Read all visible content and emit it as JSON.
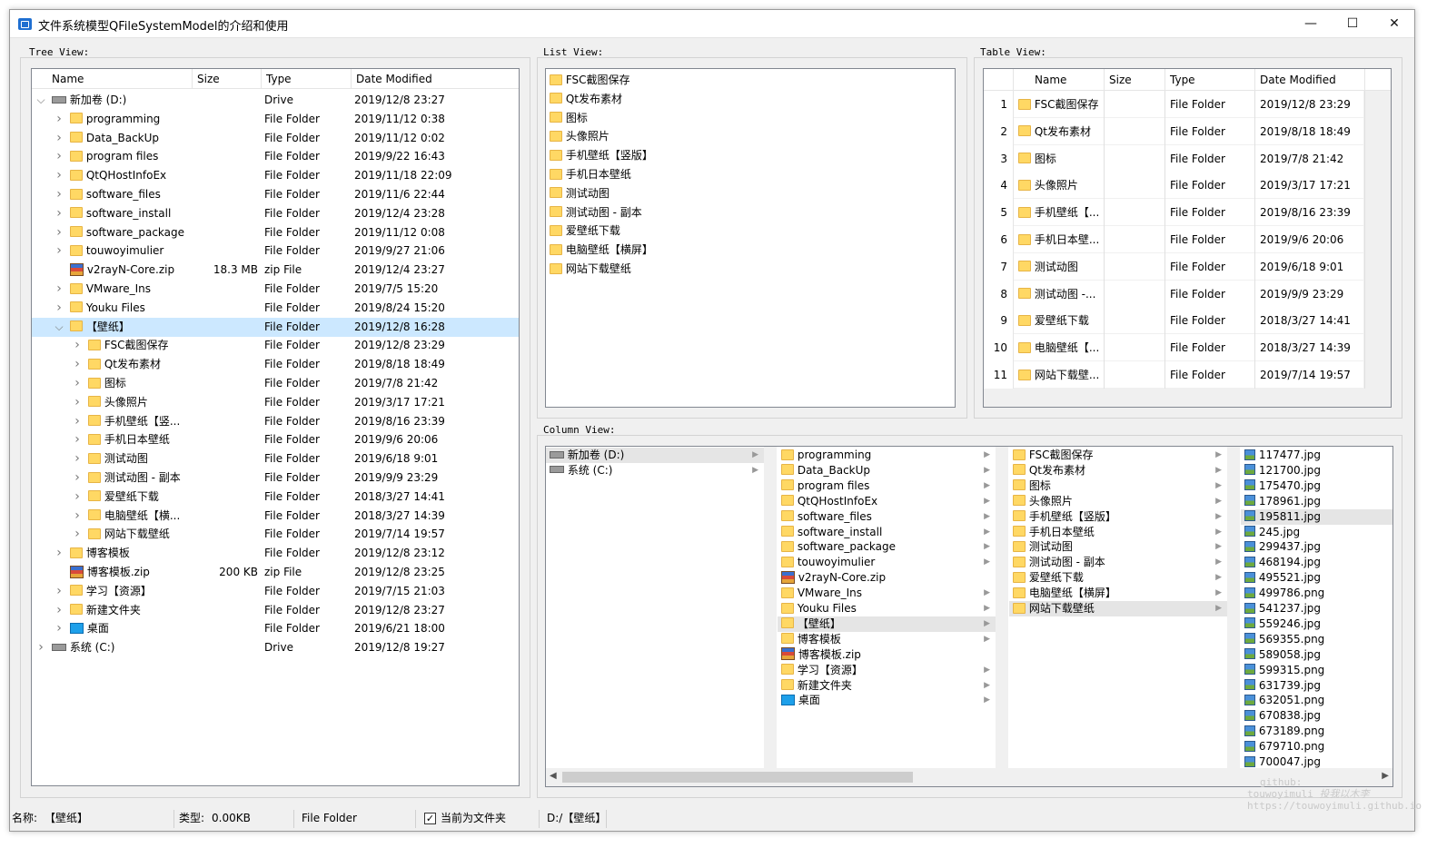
{
  "window": {
    "title": "文件系统模型QFileSystemModel的介绍和使用",
    "minimize": "—",
    "maximize": "☐",
    "close": "✕"
  },
  "groups": {
    "tree": "Tree View:",
    "list": "List View:",
    "table": "Table View:",
    "column": "Column View:"
  },
  "tree": {
    "headers": [
      "Name",
      "Size",
      "Type",
      "Date Modified"
    ],
    "rows": [
      {
        "name": "新加卷 (D:)",
        "size": "",
        "type": "Drive",
        "date": "2019/12/8 23:27",
        "icon": "drive",
        "level": 0,
        "exp": "v"
      },
      {
        "name": "programming",
        "size": "",
        "type": "File Folder",
        "date": "2019/11/12 0:38",
        "icon": "folder",
        "level": 1,
        "exp": ">"
      },
      {
        "name": "Data_BackUp",
        "size": "",
        "type": "File Folder",
        "date": "2019/11/12 0:02",
        "icon": "folder",
        "level": 1,
        "exp": ">"
      },
      {
        "name": "program files",
        "size": "",
        "type": "File Folder",
        "date": "2019/9/22 16:43",
        "icon": "folder",
        "level": 1,
        "exp": ">"
      },
      {
        "name": "QtQHostInfoEx",
        "size": "",
        "type": "File Folder",
        "date": "2019/11/18 22:09",
        "icon": "folder",
        "level": 1,
        "exp": ">"
      },
      {
        "name": "software_files",
        "size": "",
        "type": "File Folder",
        "date": "2019/11/6 22:44",
        "icon": "folder",
        "level": 1,
        "exp": ">"
      },
      {
        "name": "software_install",
        "size": "",
        "type": "File Folder",
        "date": "2019/12/4 23:28",
        "icon": "folder",
        "level": 1,
        "exp": ">"
      },
      {
        "name": "software_package",
        "size": "",
        "type": "File Folder",
        "date": "2019/11/12 0:08",
        "icon": "folder",
        "level": 1,
        "exp": ">"
      },
      {
        "name": "touwoyimulier",
        "size": "",
        "type": "File Folder",
        "date": "2019/9/27 21:06",
        "icon": "folder",
        "level": 1,
        "exp": ">"
      },
      {
        "name": "v2rayN-Core.zip",
        "size": "18.3 MB",
        "type": "zip File",
        "date": "2019/12/4 23:27",
        "icon": "zip",
        "level": 1,
        "exp": ""
      },
      {
        "name": "VMware_Ins",
        "size": "",
        "type": "File Folder",
        "date": "2019/7/5 15:20",
        "icon": "folder",
        "level": 1,
        "exp": ">"
      },
      {
        "name": "Youku Files",
        "size": "",
        "type": "File Folder",
        "date": "2019/8/24 15:20",
        "icon": "folder",
        "level": 1,
        "exp": ">"
      },
      {
        "name": "【壁纸】",
        "size": "",
        "type": "File Folder",
        "date": "2019/12/8 16:28",
        "icon": "folder",
        "level": 1,
        "exp": "v",
        "sel": true
      },
      {
        "name": "FSC截图保存",
        "size": "",
        "type": "File Folder",
        "date": "2019/12/8 23:29",
        "icon": "folder",
        "level": 2,
        "exp": ">"
      },
      {
        "name": "Qt发布素材",
        "size": "",
        "type": "File Folder",
        "date": "2019/8/18 18:49",
        "icon": "folder",
        "level": 2,
        "exp": ">"
      },
      {
        "name": "图标",
        "size": "",
        "type": "File Folder",
        "date": "2019/7/8 21:42",
        "icon": "folder",
        "level": 2,
        "exp": ">"
      },
      {
        "name": "头像照片",
        "size": "",
        "type": "File Folder",
        "date": "2019/3/17 17:21",
        "icon": "folder",
        "level": 2,
        "exp": ">"
      },
      {
        "name": "手机壁纸【竖...",
        "size": "",
        "type": "File Folder",
        "date": "2019/8/16 23:39",
        "icon": "folder",
        "level": 2,
        "exp": ">"
      },
      {
        "name": "手机日本壁纸",
        "size": "",
        "type": "File Folder",
        "date": "2019/9/6 20:06",
        "icon": "folder",
        "level": 2,
        "exp": ">"
      },
      {
        "name": "测试动图",
        "size": "",
        "type": "File Folder",
        "date": "2019/6/18 9:01",
        "icon": "folder",
        "level": 2,
        "exp": ">"
      },
      {
        "name": "测试动图 - 副本",
        "size": "",
        "type": "File Folder",
        "date": "2019/9/9 23:29",
        "icon": "folder",
        "level": 2,
        "exp": ">"
      },
      {
        "name": "爱壁纸下载",
        "size": "",
        "type": "File Folder",
        "date": "2018/3/27 14:41",
        "icon": "folder",
        "level": 2,
        "exp": ">"
      },
      {
        "name": "电脑壁纸【横...",
        "size": "",
        "type": "File Folder",
        "date": "2018/3/27 14:39",
        "icon": "folder",
        "level": 2,
        "exp": ">"
      },
      {
        "name": "网站下载壁纸",
        "size": "",
        "type": "File Folder",
        "date": "2019/7/14 19:57",
        "icon": "folder",
        "level": 2,
        "exp": ">"
      },
      {
        "name": "博客模板",
        "size": "",
        "type": "File Folder",
        "date": "2019/12/8 23:12",
        "icon": "folder",
        "level": 1,
        "exp": ">"
      },
      {
        "name": "博客模板.zip",
        "size": "200 KB",
        "type": "zip File",
        "date": "2019/12/8 23:25",
        "icon": "zip",
        "level": 1,
        "exp": ""
      },
      {
        "name": "学习【资源】",
        "size": "",
        "type": "File Folder",
        "date": "2019/7/15 21:03",
        "icon": "folder",
        "level": 1,
        "exp": ">"
      },
      {
        "name": "新建文件夹",
        "size": "",
        "type": "File Folder",
        "date": "2019/12/8 23:27",
        "icon": "folder",
        "level": 1,
        "exp": ">"
      },
      {
        "name": "桌面",
        "size": "",
        "type": "File Folder",
        "date": "2019/6/21 18:00",
        "icon": "desk",
        "level": 1,
        "exp": ">"
      },
      {
        "name": "系统 (C:)",
        "size": "",
        "type": "Drive",
        "date": "2019/12/8 19:27",
        "icon": "drive",
        "level": 0,
        "exp": ">"
      }
    ]
  },
  "list": {
    "items": [
      "FSC截图保存",
      "Qt发布素材",
      "图标",
      "头像照片",
      "手机壁纸【竖版】",
      "手机日本壁纸",
      "测试动图",
      "测试动图 - 副本",
      "爱壁纸下载",
      "电脑壁纸【横屏】",
      "网站下载壁纸"
    ]
  },
  "table": {
    "headers": [
      "Name",
      "Size",
      "Type",
      "Date Modified"
    ],
    "rows": [
      {
        "n": "1",
        "name": "FSC截图保存",
        "size": "",
        "type": "File Folder",
        "date": "2019/12/8 23:29"
      },
      {
        "n": "2",
        "name": "Qt发布素材",
        "size": "",
        "type": "File Folder",
        "date": "2019/8/18 18:49"
      },
      {
        "n": "3",
        "name": "图标",
        "size": "",
        "type": "File Folder",
        "date": "2019/7/8 21:42"
      },
      {
        "n": "4",
        "name": "头像照片",
        "size": "",
        "type": "File Folder",
        "date": "2019/3/17 17:21"
      },
      {
        "n": "5",
        "name": "手机壁纸【...",
        "size": "",
        "type": "File Folder",
        "date": "2019/8/16 23:39"
      },
      {
        "n": "6",
        "name": "手机日本壁...",
        "size": "",
        "type": "File Folder",
        "date": "2019/9/6 20:06"
      },
      {
        "n": "7",
        "name": "测试动图",
        "size": "",
        "type": "File Folder",
        "date": "2019/6/18 9:01"
      },
      {
        "n": "8",
        "name": "测试动图 -...",
        "size": "",
        "type": "File Folder",
        "date": "2019/9/9 23:29"
      },
      {
        "n": "9",
        "name": "爱壁纸下载",
        "size": "",
        "type": "File Folder",
        "date": "2018/3/27 14:41"
      },
      {
        "n": "10",
        "name": "电脑壁纸【...",
        "size": "",
        "type": "File Folder",
        "date": "2018/3/27 14:39"
      },
      {
        "n": "11",
        "name": "网站下载壁...",
        "size": "",
        "type": "File Folder",
        "date": "2019/7/14 19:57"
      }
    ]
  },
  "column": {
    "col1": [
      {
        "name": "新加卷 (D:)",
        "icon": "drive",
        "arrow": true,
        "sel": true
      },
      {
        "name": "系统 (C:)",
        "icon": "drive",
        "arrow": true
      }
    ],
    "col2": [
      {
        "name": "programming",
        "icon": "folder",
        "arrow": true
      },
      {
        "name": "Data_BackUp",
        "icon": "folder",
        "arrow": true
      },
      {
        "name": "program files",
        "icon": "folder",
        "arrow": true
      },
      {
        "name": "QtQHostInfoEx",
        "icon": "folder",
        "arrow": true
      },
      {
        "name": "software_files",
        "icon": "folder",
        "arrow": true
      },
      {
        "name": "software_install",
        "icon": "folder",
        "arrow": true
      },
      {
        "name": "software_package",
        "icon": "folder",
        "arrow": true
      },
      {
        "name": "touwoyimulier",
        "icon": "folder",
        "arrow": true
      },
      {
        "name": "v2rayN-Core.zip",
        "icon": "zip",
        "arrow": false
      },
      {
        "name": "VMware_Ins",
        "icon": "folder",
        "arrow": true
      },
      {
        "name": "Youku Files",
        "icon": "folder",
        "arrow": true
      },
      {
        "name": "【壁纸】",
        "icon": "folder",
        "arrow": true,
        "sel": true
      },
      {
        "name": "博客模板",
        "icon": "folder",
        "arrow": true
      },
      {
        "name": "博客模板.zip",
        "icon": "zip",
        "arrow": false
      },
      {
        "name": "学习【资源】",
        "icon": "folder",
        "arrow": true
      },
      {
        "name": "新建文件夹",
        "icon": "folder",
        "arrow": true
      },
      {
        "name": "桌面",
        "icon": "desk",
        "arrow": true
      }
    ],
    "col3": [
      {
        "name": "FSC截图保存",
        "icon": "folder",
        "arrow": true
      },
      {
        "name": "Qt发布素材",
        "icon": "folder",
        "arrow": true
      },
      {
        "name": "图标",
        "icon": "folder",
        "arrow": true
      },
      {
        "name": "头像照片",
        "icon": "folder",
        "arrow": true
      },
      {
        "name": "手机壁纸【竖版】",
        "icon": "folder",
        "arrow": true
      },
      {
        "name": "手机日本壁纸",
        "icon": "folder",
        "arrow": true
      },
      {
        "name": "测试动图",
        "icon": "folder",
        "arrow": true
      },
      {
        "name": "测试动图 - 副本",
        "icon": "folder",
        "arrow": true
      },
      {
        "name": "爱壁纸下载",
        "icon": "folder",
        "arrow": true
      },
      {
        "name": "电脑壁纸【横屏】",
        "icon": "folder",
        "arrow": true
      },
      {
        "name": "网站下载壁纸",
        "icon": "folder",
        "arrow": true,
        "sel": true
      }
    ],
    "col4": [
      {
        "name": "117477.jpg",
        "icon": "img"
      },
      {
        "name": "121700.jpg",
        "icon": "img"
      },
      {
        "name": "175470.jpg",
        "icon": "img"
      },
      {
        "name": "178961.jpg",
        "icon": "img"
      },
      {
        "name": "195811.jpg",
        "icon": "img",
        "sel": true
      },
      {
        "name": "245.jpg",
        "icon": "img"
      },
      {
        "name": "299437.jpg",
        "icon": "img"
      },
      {
        "name": "468194.jpg",
        "icon": "img"
      },
      {
        "name": "495521.jpg",
        "icon": "img"
      },
      {
        "name": "499786.png",
        "icon": "img"
      },
      {
        "name": "541237.jpg",
        "icon": "img"
      },
      {
        "name": "559246.jpg",
        "icon": "img"
      },
      {
        "name": "569355.png",
        "icon": "img"
      },
      {
        "name": "589058.jpg",
        "icon": "img"
      },
      {
        "name": "599315.png",
        "icon": "img"
      },
      {
        "name": "631739.jpg",
        "icon": "img"
      },
      {
        "name": "632051.png",
        "icon": "img"
      },
      {
        "name": "670838.jpg",
        "icon": "img"
      },
      {
        "name": "673189.png",
        "icon": "img"
      },
      {
        "name": "679710.png",
        "icon": "img"
      },
      {
        "name": "700047.jpg",
        "icon": "img"
      }
    ]
  },
  "status": {
    "name_label": "名称:",
    "name_value": "【壁纸】",
    "type_label": "类型:",
    "type_value": "0.00KB",
    "file_type": "File Folder",
    "is_dir_label": "当前为文件夹",
    "path": "D:/【壁纸】"
  },
  "watermark": {
    "line1": "github:",
    "line2": "touwoyimuli",
    "line3": "https://touwoyimuli.github.io",
    "sig": "投我以木李"
  }
}
